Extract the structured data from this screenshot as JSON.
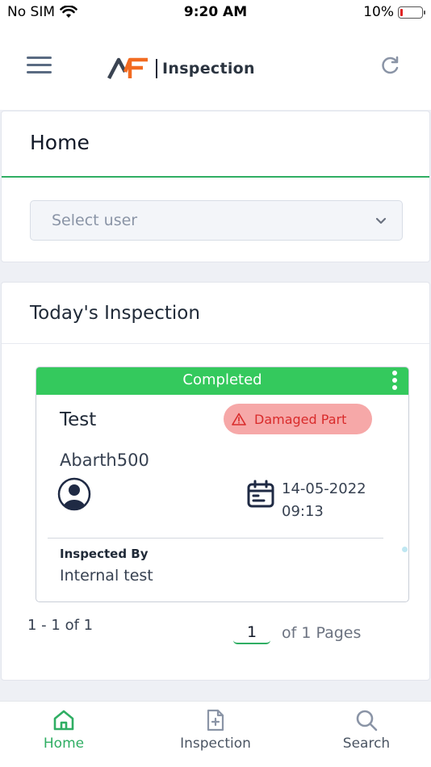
{
  "status_bar": {
    "carrier": "No SIM",
    "time": "9:20 AM",
    "battery": "10%",
    "battery_level": 0.1
  },
  "header": {
    "logo_mark": "AF",
    "logo_text": "Inspection",
    "menu_icon": "hamburger-icon",
    "refresh_icon": "refresh-icon"
  },
  "home_card": {
    "title": "Home",
    "select_user": {
      "placeholder": "Select user"
    }
  },
  "today_card": {
    "title": "Today's Inspection",
    "inspection": {
      "status": "Completed",
      "status_color": "#34c95d",
      "name": "Test",
      "badge": "Damaged Part",
      "badge_color": "#f6a8a8",
      "model": "Abarth500",
      "date": "14-05-2022",
      "time": "09:13",
      "inspected_by_label": "Inspected By",
      "inspected_by": "Internal test"
    },
    "pagination": {
      "range": "1 - 1 of 1",
      "current_page": "1",
      "total_text": "of 1 Pages"
    }
  },
  "tab_bar": {
    "items": [
      {
        "label": "Home",
        "icon": "home-icon",
        "active": true
      },
      {
        "label": "Inspection",
        "icon": "document-add-icon",
        "active": false
      },
      {
        "label": "Search",
        "icon": "search-icon",
        "active": false
      }
    ]
  },
  "colors": {
    "accent": "#2fae63",
    "brand_orange": "#f26b21"
  }
}
